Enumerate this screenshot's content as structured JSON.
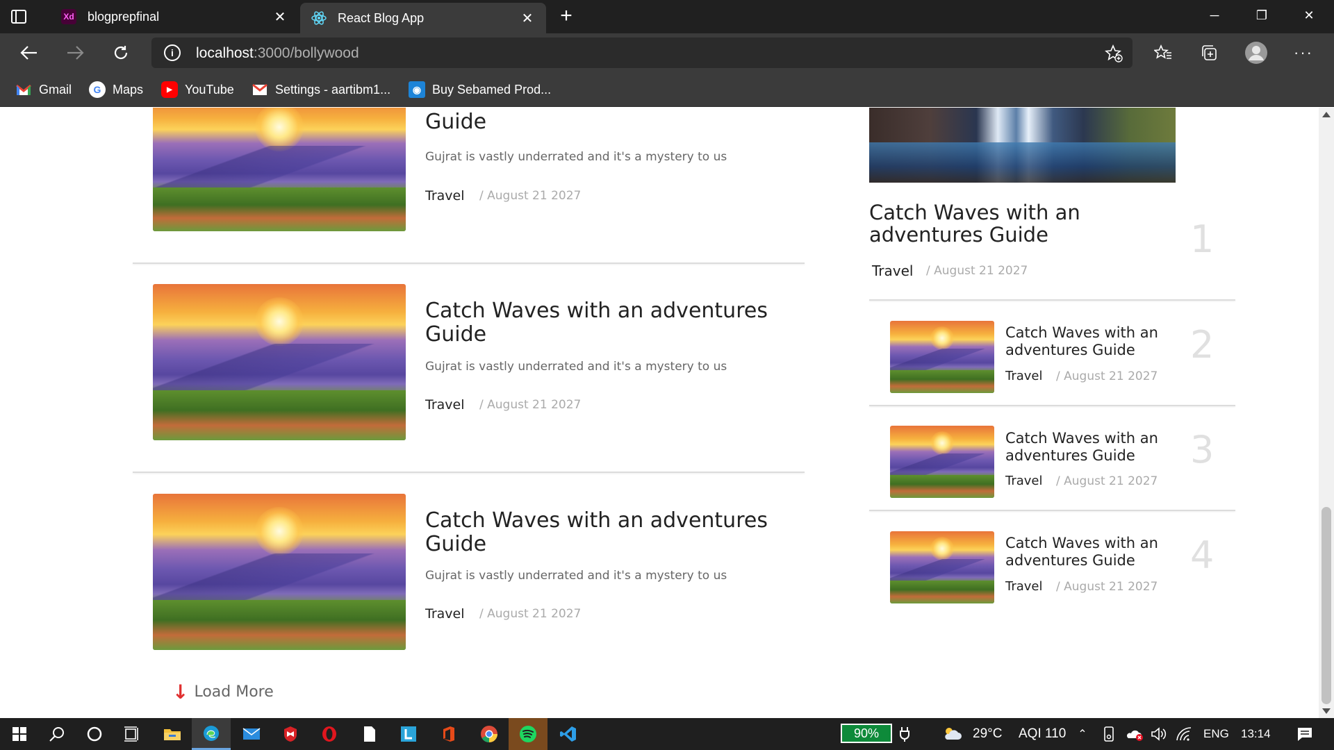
{
  "browser": {
    "tabs": [
      {
        "label": "blogprepfinal",
        "favicon": "adobe-xd-icon",
        "favicon_text": "Xd",
        "active": false
      },
      {
        "label": "React Blog App",
        "favicon": "react-icon",
        "active": true
      }
    ],
    "url_host": "localhost",
    "url_path": ":3000/bollywood",
    "bookmarks": [
      {
        "label": "Gmail",
        "icon": "gmail-icon"
      },
      {
        "label": "Maps",
        "icon": "google-icon"
      },
      {
        "label": "YouTube",
        "icon": "youtube-icon"
      },
      {
        "label": "Settings - aartibm1...",
        "icon": "gmail-icon"
      },
      {
        "label": "Buy Sebamed Prod...",
        "icon": "sebamed-icon"
      }
    ]
  },
  "posts": [
    {
      "title": "Catch Waves with an adventures Guide",
      "description": "Gujrat is vastly underrated and it's a mystery to us",
      "category": "Travel",
      "date": "/ August 21 2027"
    },
    {
      "title": "Catch Waves with an adventures Guide",
      "description": "Gujrat is vastly underrated and it's a mystery to us",
      "category": "Travel",
      "date": "/ August 21 2027"
    },
    {
      "title": "Catch Waves with an adventures Guide",
      "description": "Gujrat is vastly underrated and it's a mystery to us",
      "category": "Travel",
      "date": "/ August 21 2027"
    }
  ],
  "load_more": "Load More",
  "sidebar": {
    "featured": {
      "title": "Catch Waves with an adventures Guide",
      "category": "Travel",
      "date": "/ August 21 2027",
      "rank": "1"
    },
    "items": [
      {
        "title": "Catch Waves with an adventures Guide",
        "category": "Travel",
        "date": "/ August 21 2027",
        "rank": "2"
      },
      {
        "title": "Catch Waves with an adventures Guide",
        "category": "Travel",
        "date": "/ August 21 2027",
        "rank": "3"
      },
      {
        "title": "Catch Waves with an adventures Guide",
        "category": "Travel",
        "date": "/ August 21 2027",
        "rank": "4"
      }
    ]
  },
  "taskbar": {
    "battery": "90%",
    "weather": "29°C",
    "aqi": "AQI 110",
    "language": "ENG",
    "time": "13:14"
  },
  "colors": {
    "accent": "#e03030",
    "battery_green": "#0e8a3a"
  }
}
